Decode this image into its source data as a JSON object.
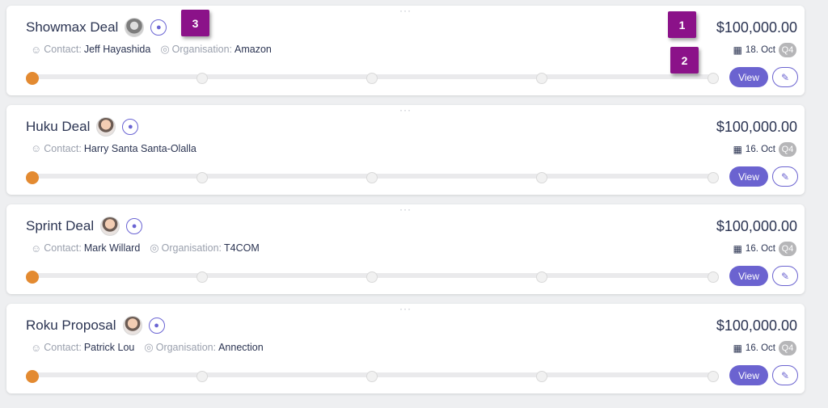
{
  "deals": [
    {
      "title": "Showmax Deal",
      "contact_label": "Contact:",
      "contact": "Jeff Hayashida",
      "org_label": "Organisation:",
      "organisation": "Amazon",
      "amount": "$100,000.00",
      "date": "18. Oct",
      "quarter": "Q4",
      "view_label": "View",
      "avatar": "gray"
    },
    {
      "title": "Huku Deal",
      "contact_label": "Contact:",
      "contact": "Harry Santa Santa-Olalla",
      "amount": "$100,000.00",
      "date": "16. Oct",
      "quarter": "Q4",
      "view_label": "View",
      "avatar": "person"
    },
    {
      "title": "Sprint Deal",
      "contact_label": "Contact:",
      "contact": "Mark Willard",
      "org_label": "Organisation:",
      "organisation": "T4COM",
      "amount": "$100,000.00",
      "date": "16. Oct",
      "quarter": "Q4",
      "view_label": "View",
      "avatar": "person"
    },
    {
      "title": "Roku Proposal",
      "contact_label": "Contact:",
      "contact": "Patrick Lou",
      "org_label": "Organisation:",
      "organisation": "Annection",
      "amount": "$100,000.00",
      "date": "16. Oct",
      "quarter": "Q4",
      "view_label": "View",
      "avatar": "person"
    }
  ],
  "callouts": [
    "1",
    "2",
    "3"
  ],
  "colors": {
    "accent": "#6b63d0",
    "stage_active": "#e38a31",
    "callout": "#8b1289"
  },
  "icons": {
    "contact": "user-icon",
    "organisation": "globe-icon",
    "date": "calendar-icon",
    "tag": "tag-icon",
    "edit": "pencil-icon"
  }
}
